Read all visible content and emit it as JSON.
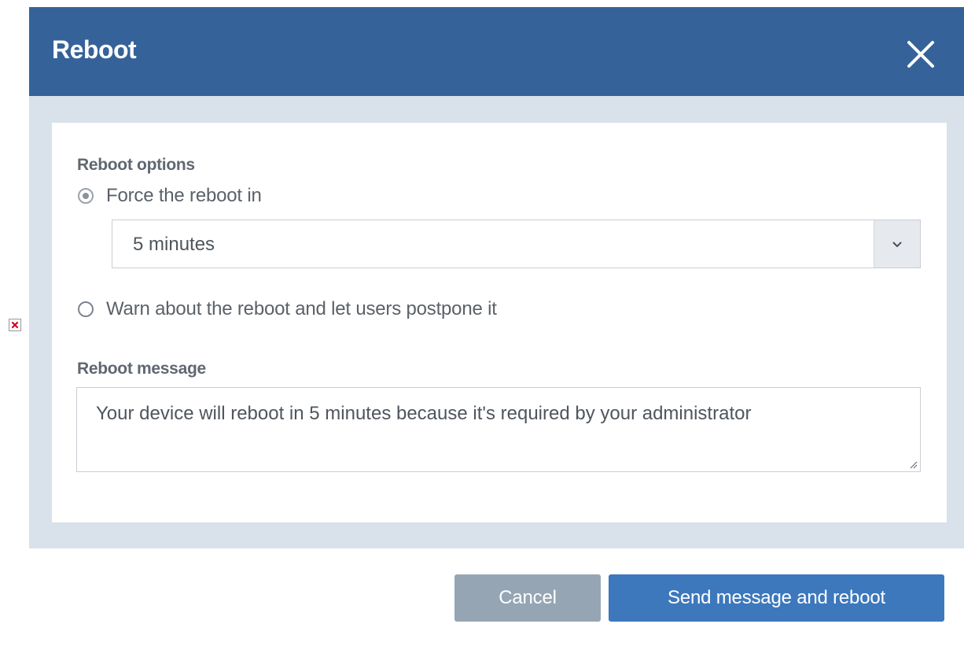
{
  "dialog": {
    "title": "Reboot",
    "close_icon": "close-icon"
  },
  "form": {
    "reboot_options_label": "Reboot options",
    "options": [
      {
        "label": "Force the reboot in",
        "selected": true
      },
      {
        "label": "Warn about the reboot and let users postpone it",
        "selected": false
      }
    ],
    "delay_select": {
      "value": "5 minutes",
      "icon": "chevron-down-icon"
    },
    "message_label": "Reboot message",
    "message_value": "Your device will reboot in 5 minutes because it's required by your administrator"
  },
  "footer": {
    "cancel_label": "Cancel",
    "submit_label": "Send message and reboot"
  },
  "colors": {
    "header": "#356299",
    "body_background": "#d9e1ea",
    "primary_button": "#3d78bd",
    "cancel_button": "#95a5b4"
  }
}
